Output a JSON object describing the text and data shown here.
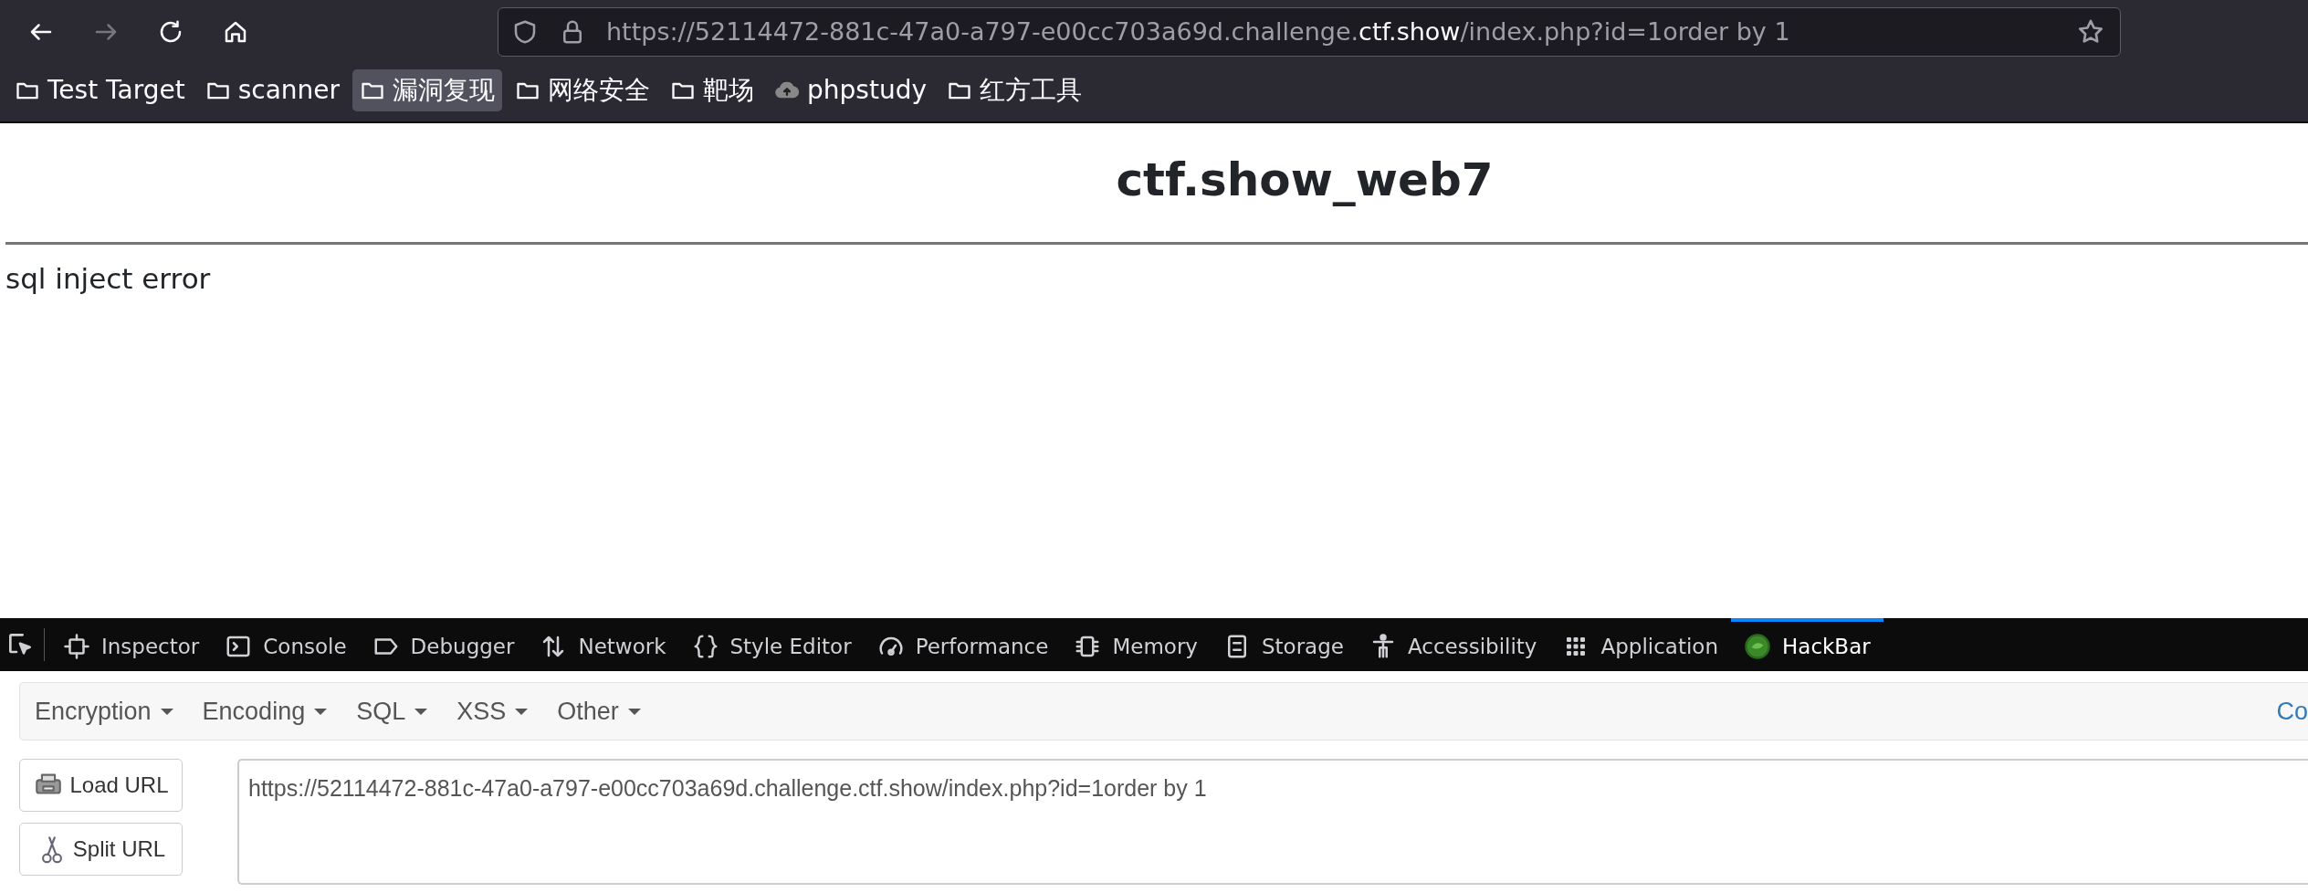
{
  "nav": [
    {
      "kind": "back",
      "disabled": false
    },
    {
      "kind": "forward",
      "disabled": true
    },
    {
      "kind": "reload",
      "disabled": false
    },
    {
      "kind": "home",
      "disabled": false
    }
  ],
  "address": {
    "prefix": "https://52114472-881c-47a0-a797-e00cc703a69d.challenge.",
    "domain": "ctf.show",
    "suffix": "/index.php?id=1order by 1"
  },
  "bookmarks": [
    {
      "label": "Test Target",
      "kind": "folder",
      "selected": false
    },
    {
      "label": "scanner",
      "kind": "folder",
      "selected": false
    },
    {
      "label": "漏洞复现",
      "kind": "folder",
      "selected": true
    },
    {
      "label": "网络安全",
      "kind": "folder",
      "selected": false
    },
    {
      "label": "靶场",
      "kind": "folder",
      "selected": false
    },
    {
      "label": "phpstudy",
      "kind": "site",
      "selected": false
    },
    {
      "label": "红方工具",
      "kind": "folder",
      "selected": false
    }
  ],
  "page": {
    "heading": "ctf.show_web7",
    "message": "sql inject error"
  },
  "devtools_tabs": [
    {
      "label": "Inspector",
      "kind": "inspector",
      "selected": false
    },
    {
      "label": "Console",
      "kind": "console",
      "selected": false
    },
    {
      "label": "Debugger",
      "kind": "debugger",
      "selected": false
    },
    {
      "label": "Network",
      "kind": "network",
      "selected": false
    },
    {
      "label": "Style Editor",
      "kind": "style",
      "selected": false
    },
    {
      "label": "Performance",
      "kind": "performance",
      "selected": false
    },
    {
      "label": "Memory",
      "kind": "memory",
      "selected": false
    },
    {
      "label": "Storage",
      "kind": "storage",
      "selected": false
    },
    {
      "label": "Accessibility",
      "kind": "accessibility",
      "selected": false
    },
    {
      "label": "Application",
      "kind": "application",
      "selected": false
    },
    {
      "label": "HackBar",
      "kind": "hackbar",
      "selected": true
    }
  ],
  "hackbar": {
    "menus": [
      "Encryption",
      "Encoding",
      "SQL",
      "XSS",
      "Other"
    ],
    "menu_right": "Co",
    "buttons": [
      {
        "label": "Load URL",
        "kind": "load"
      },
      {
        "label": "Split URL",
        "kind": "split"
      }
    ],
    "url_value": "https://52114472-881c-47a0-a797-e00cc703a69d.challenge.ctf.show/index.php?id=1order by 1"
  }
}
